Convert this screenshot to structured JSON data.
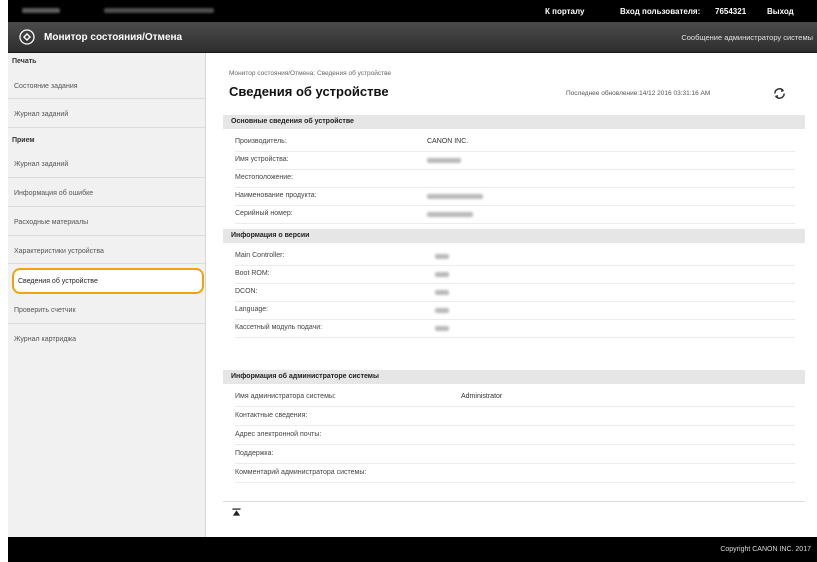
{
  "topbar": {
    "portal_label": "К порталу",
    "login_label": "Вход пользователя:",
    "user_id": "7654321",
    "logout_label": "Выход"
  },
  "titlebar": {
    "title": "Монитор состояния/Отмена",
    "admin_message": "Сообщение администратору системы"
  },
  "sidebar": {
    "sections": [
      {
        "title": "Печать",
        "items": [
          "Состояние задания",
          "Журнал заданий"
        ]
      },
      {
        "title": "Прием",
        "items": [
          "Журнал заданий",
          "Информация об ошибке",
          "Расходные материалы",
          "Характеристики устройства",
          "Сведения об устройстве",
          "Проверить счетчик",
          "Журнал картриджа"
        ]
      }
    ],
    "active_item": "Сведения об устройстве"
  },
  "main": {
    "breadcrumb": "Монитор состояния/Отмена: Сведения об устройстве",
    "title": "Сведения об устройстве",
    "last_updated": "Последнее обновление:14/12 2016 03:31:16 AM",
    "sections": [
      {
        "title": "Основные сведения об устройстве",
        "rows": [
          {
            "label": "Производитель:",
            "value": "CANON INC."
          },
          {
            "label": "Имя устройства:",
            "value": ""
          },
          {
            "label": "Местоположение:",
            "value": ""
          },
          {
            "label": "Наименование продукта:",
            "value": ""
          },
          {
            "label": "Серийный номер:",
            "value": ""
          }
        ]
      },
      {
        "title": "Информация о версии",
        "rows": [
          {
            "label": "Main Controller:",
            "value": ""
          },
          {
            "label": "Boot ROM:",
            "value": ""
          },
          {
            "label": "DCON:",
            "value": ""
          },
          {
            "label": "Language:",
            "value": ""
          },
          {
            "label": "Кассетный модуль подачи:",
            "value": ""
          }
        ]
      },
      {
        "title": "Информация об администраторе системы",
        "rows": [
          {
            "label": "Имя администратора системы:",
            "value": "Administrator"
          },
          {
            "label": "Контактные сведения:",
            "value": ""
          },
          {
            "label": "Адрес электронной почты:",
            "value": ""
          },
          {
            "label": "Поддержка:",
            "value": ""
          },
          {
            "label": "Комментарий администратора системы:",
            "value": ""
          }
        ]
      }
    ]
  },
  "footer": {
    "copyright": "Copyright CANON INC. 2017"
  },
  "colors": {
    "highlight": "#f3a20a",
    "topbar": "#000000",
    "titlebar": "#3a3a3a"
  },
  "icons": {
    "app": "monitor-icon",
    "refresh": "refresh-icon",
    "top": "back-to-top-icon"
  }
}
